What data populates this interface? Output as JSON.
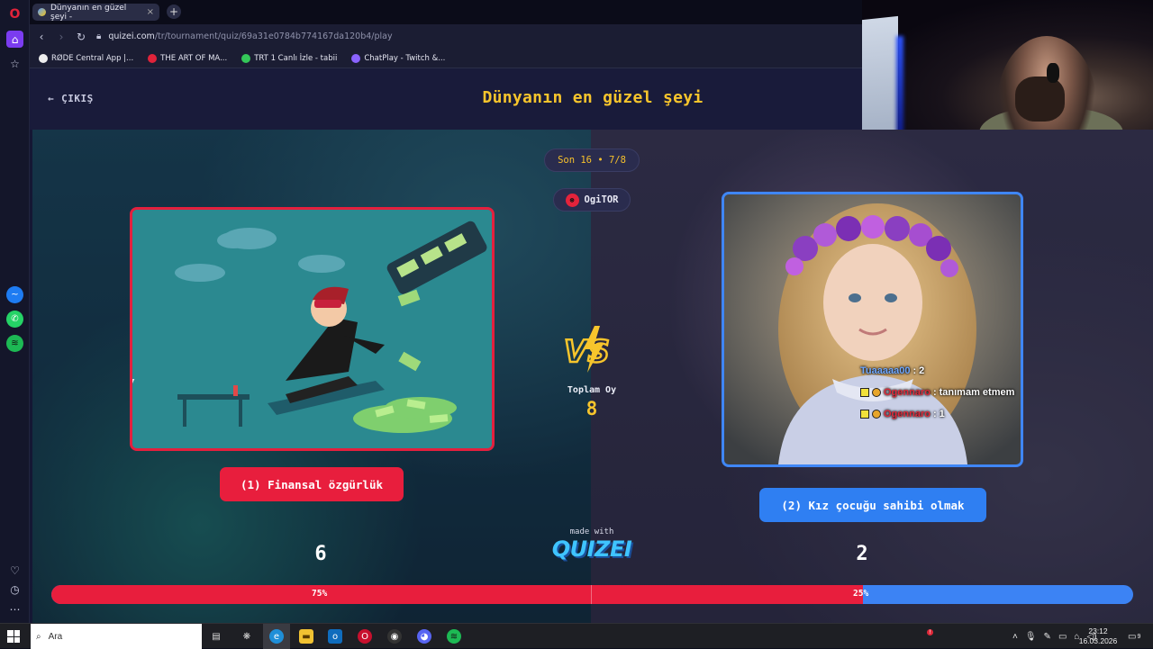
{
  "browser": {
    "tab_title": "Dünyanın en güzel şeyi -",
    "tab_close": "×",
    "new_tab": "+",
    "url_domain": "quizei.com",
    "url_path": "/tr/tournament/quiz/69a31e0784b774167da120b4/play",
    "bookmarks": [
      {
        "label": "RØDE Central App |...",
        "color": "#eeeeee"
      },
      {
        "label": "THE ART OF MA...",
        "color": "#e0233a"
      },
      {
        "label": "TRT 1 Canlı İzle - tabii",
        "color": "#34c759"
      },
      {
        "label": "ChatPlay - Twitch &...",
        "color": "#8a63ff"
      }
    ]
  },
  "quiz": {
    "exit_label": "ÇIKIŞ",
    "title": "Dünyanın en güzel şeyi",
    "round": "Son 16 • 7/8",
    "user": "OgiTOR",
    "vs_label": "VS",
    "total_votes_label": "Toplam Oy",
    "total_votes": "8",
    "made_with": "made with",
    "brand": "QUIZEI",
    "left": {
      "label": "(1) Finansal özgürlük",
      "votes": "6",
      "percent_label": "75%",
      "percent": 75,
      "color": "#e81e3d"
    },
    "right": {
      "label": "(2) Kız çocuğu sahibi olmak",
      "votes": "2",
      "percent_label": "25%",
      "percent": 25,
      "color": "#2f7ff2"
    }
  },
  "chat": [
    {
      "user": "Tuaaaaa00",
      "sep": ": ",
      "message": "2"
    },
    {
      "user": "Ogennaro",
      "sep": ": ",
      "message": "tanımam etmem"
    },
    {
      "user": "Ogennaro",
      "sep": ": ",
      "message": "1"
    }
  ],
  "taskbar": {
    "search_placeholder": "Ara",
    "time": "23:12",
    "date": "16.03.2026",
    "notification_count": "9"
  },
  "colors": {
    "accent_yellow": "#f7c52c",
    "left_red": "#e81e3d",
    "right_blue": "#2f7ff2"
  }
}
